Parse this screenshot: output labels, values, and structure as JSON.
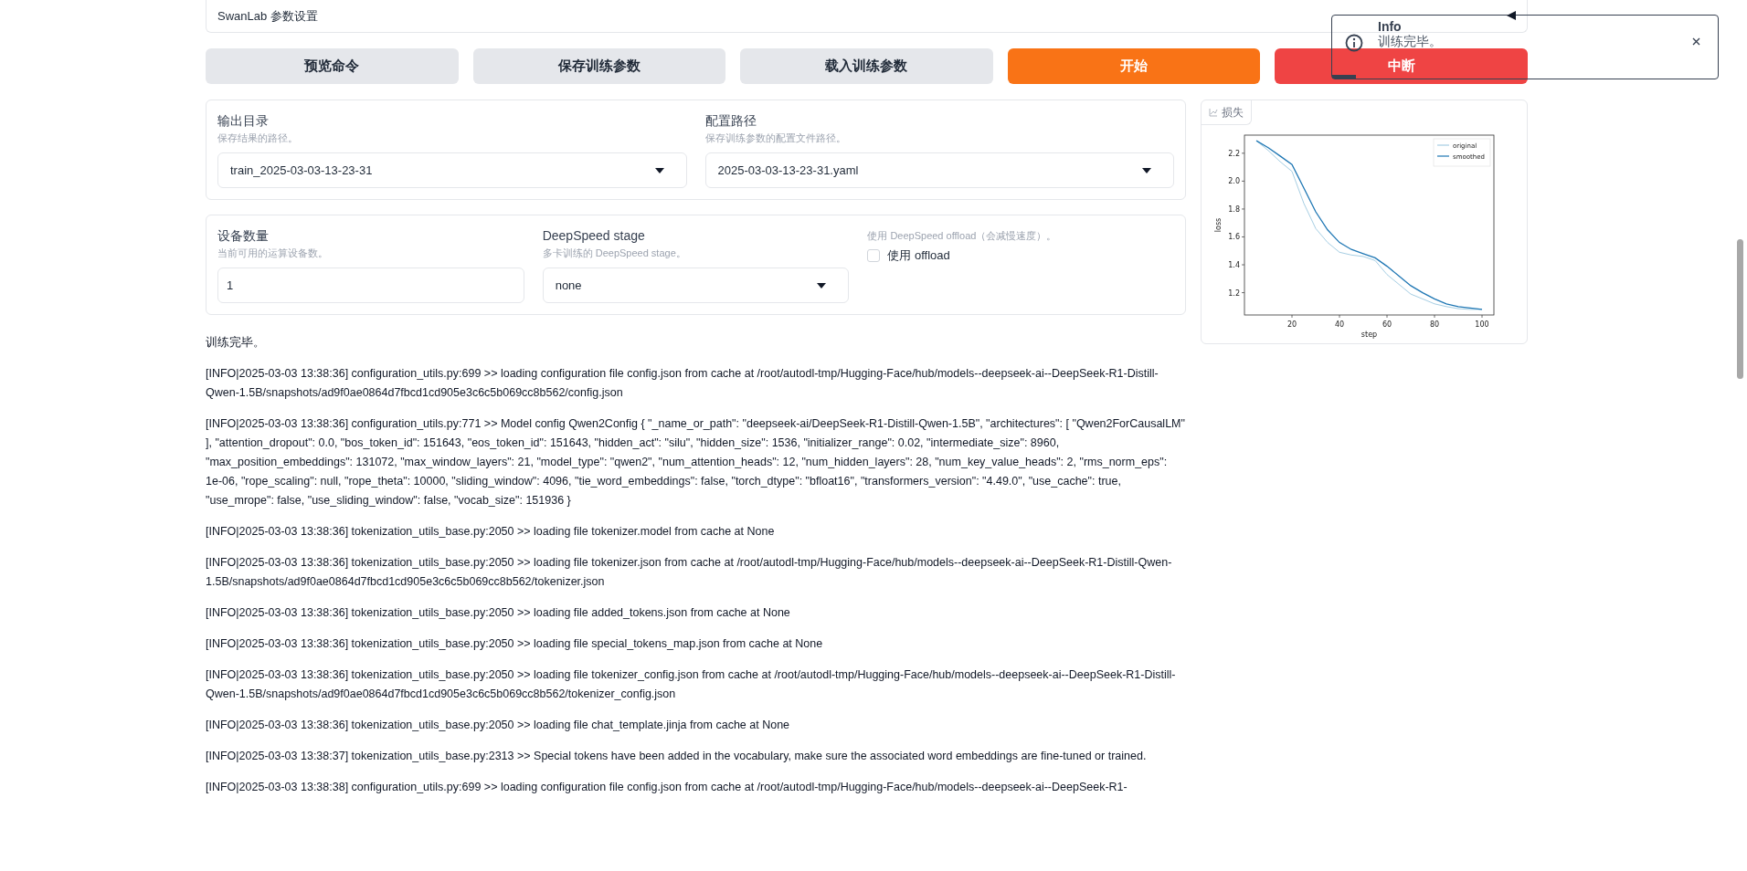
{
  "panel_header": "SwanLab 参数设置",
  "buttons": [
    {
      "label": "预览命令",
      "kind": "secondary"
    },
    {
      "label": "保存训练参数",
      "kind": "secondary"
    },
    {
      "label": "载入训练参数",
      "kind": "secondary"
    },
    {
      "label": "开始",
      "kind": "primary"
    },
    {
      "label": "中断",
      "kind": "stop"
    }
  ],
  "path_settings": [
    {
      "label": "输出目录",
      "info": "保存结果的路径。",
      "value": "train_2025-03-03-13-23-31"
    },
    {
      "label": "配置路径",
      "info": "保存训练参数的配置文件路径。",
      "value": "2025-03-03-13-23-31.yaml"
    }
  ],
  "device_settings": {
    "device_count": {
      "label": "设备数量",
      "info": "当前可用的运算设备数。",
      "value": "1"
    },
    "deepspeed_stage": {
      "label": "DeepSpeed stage",
      "info": "多卡训练的 DeepSpeed stage。",
      "value": "none"
    },
    "offload": {
      "info": "使用 DeepSpeed offload（会减慢速度）。",
      "label": "使用 offload",
      "checked": false
    }
  },
  "loss_plot": {
    "label": "损失",
    "chart_data": {
      "type": "line",
      "xlabel": "step",
      "ylabel": "loss",
      "x": [
        5,
        10,
        15,
        20,
        25,
        30,
        35,
        40,
        45,
        50,
        55,
        60,
        65,
        70,
        75,
        80,
        85,
        90,
        95,
        100
      ],
      "series": [
        {
          "name": "original",
          "color": "#a6cee3",
          "values": [
            2.29,
            2.22,
            2.14,
            2.07,
            1.84,
            1.66,
            1.56,
            1.49,
            1.47,
            1.46,
            1.43,
            1.33,
            1.26,
            1.19,
            1.155,
            1.12,
            1.1,
            1.085,
            1.08,
            1.08
          ]
        },
        {
          "name": "smoothed",
          "color": "#1f77b4",
          "values": [
            2.29,
            2.24,
            2.18,
            2.12,
            1.95,
            1.78,
            1.65,
            1.56,
            1.51,
            1.48,
            1.45,
            1.39,
            1.32,
            1.25,
            1.2,
            1.155,
            1.12,
            1.1,
            1.09,
            1.08
          ]
        }
      ],
      "xlim": [
        0,
        105
      ],
      "ylim": [
        1.04,
        2.33
      ],
      "xticks": [
        20,
        40,
        60,
        80,
        100
      ],
      "yticks": [
        1.2,
        1.4,
        1.6,
        1.8,
        {
          "value": 2,
          "label": "2.0"
        },
        2.2
      ],
      "legend": true
    }
  },
  "output_log": [
    "训练完毕。",
    "[INFO|2025-03-03 13:38:36] configuration_utils.py:699 >> loading configuration file config.json from cache at /root/autodl-tmp/Hugging-Face/hub/models--deepseek-ai--DeepSeek-R1-Distill-Qwen-1.5B/snapshots/ad9f0ae0864d7fbcd1cd905e3c6c5b069cc8b562/config.json",
    "[INFO|2025-03-03 13:38:36] configuration_utils.py:771 >> Model config Qwen2Config { \"_name_or_path\": \"deepseek-ai/DeepSeek-R1-Distill-Qwen-1.5B\", \"architectures\": [ \"Qwen2ForCausalLM\" ], \"attention_dropout\": 0.0, \"bos_token_id\": 151643, \"eos_token_id\": 151643, \"hidden_act\": \"silu\", \"hidden_size\": 1536, \"initializer_range\": 0.02, \"intermediate_size\": 8960, \"max_position_embeddings\": 131072, \"max_window_layers\": 21, \"model_type\": \"qwen2\", \"num_attention_heads\": 12, \"num_hidden_layers\": 28, \"num_key_value_heads\": 2, \"rms_norm_eps\": 1e-06, \"rope_scaling\": null, \"rope_theta\": 10000, \"sliding_window\": 4096, \"tie_word_embeddings\": false, \"torch_dtype\": \"bfloat16\", \"transformers_version\": \"4.49.0\", \"use_cache\": true, \"use_mrope\": false, \"use_sliding_window\": false, \"vocab_size\": 151936 }",
    "[INFO|2025-03-03 13:38:36] tokenization_utils_base.py:2050 >> loading file tokenizer.model from cache at None",
    "[INFO|2025-03-03 13:38:36] tokenization_utils_base.py:2050 >> loading file tokenizer.json from cache at /root/autodl-tmp/Hugging-Face/hub/models--deepseek-ai--DeepSeek-R1-Distill-Qwen-1.5B/snapshots/ad9f0ae0864d7fbcd1cd905e3c6c5b069cc8b562/tokenizer.json",
    "[INFO|2025-03-03 13:38:36] tokenization_utils_base.py:2050 >> loading file added_tokens.json from cache at None",
    "[INFO|2025-03-03 13:38:36] tokenization_utils_base.py:2050 >> loading file special_tokens_map.json from cache at None",
    "[INFO|2025-03-03 13:38:36] tokenization_utils_base.py:2050 >> loading file tokenizer_config.json from cache at /root/autodl-tmp/Hugging-Face/hub/models--deepseek-ai--DeepSeek-R1-Distill-Qwen-1.5B/snapshots/ad9f0ae0864d7fbcd1cd905e3c6c5b069cc8b562/tokenizer_config.json",
    "[INFO|2025-03-03 13:38:36] tokenization_utils_base.py:2050 >> loading file chat_template.jinja from cache at None",
    "[INFO|2025-03-03 13:38:37] tokenization_utils_base.py:2313 >> Special tokens have been added in the vocabulary, make sure the associated word embeddings are fine-tuned or trained.",
    "[INFO|2025-03-03 13:38:38] configuration_utils.py:699 >> loading configuration file config.json from cache at /root/autodl-tmp/Hugging-Face/hub/models--deepseek-ai--DeepSeek-R1-"
  ],
  "toast": {
    "title": "Info",
    "message": "训练完毕。"
  }
}
